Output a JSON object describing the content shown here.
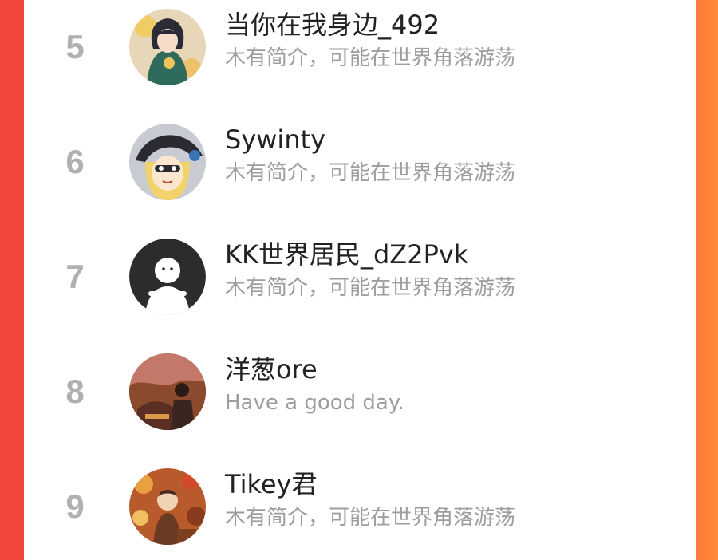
{
  "colors": {
    "background_left": "#f2463f",
    "background_right": "#ff7a3a",
    "panel": "#ffffff",
    "rank_text": "#b0b0b0",
    "name_text": "#222222",
    "bio_text": "#9d9d9d"
  },
  "list": [
    {
      "rank": "5",
      "name": "当你在我身边_492",
      "bio": "木有简介，可能在世界角落游荡",
      "avatar": "anime-character-avatar"
    },
    {
      "rank": "6",
      "name": "Sywinty",
      "bio": "木有简介，可能在世界角落游荡",
      "avatar": "blonde-witch-hat-avatar"
    },
    {
      "rank": "7",
      "name": "KK世界居民_dZ2Pvk",
      "bio": "木有简介，可能在世界角落游荡",
      "avatar": "default-user-avatar"
    },
    {
      "rank": "8",
      "name": "洋葱ore",
      "bio": "Have a good day.",
      "avatar": "illustrated-scene-avatar"
    },
    {
      "rank": "9",
      "name": "Tikey君",
      "bio": "木有简介，可能在世界角落游荡",
      "avatar": "festival-crowd-avatar"
    }
  ]
}
